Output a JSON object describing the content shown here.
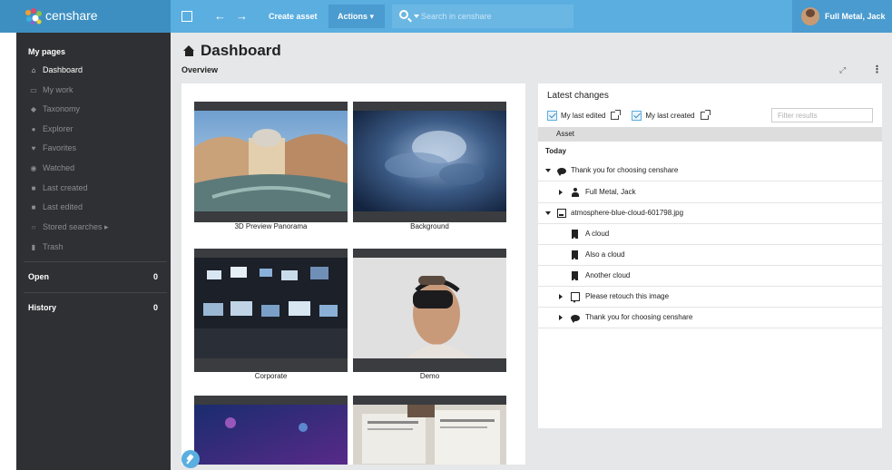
{
  "app": {
    "brand": "censhare",
    "colors": {
      "topbar": "#5aaee0",
      "logo_bg": "#3d8fc2",
      "sidebar": "#2f3033",
      "main_bg": "#e6e7e8"
    }
  },
  "topbar": {
    "panel_icon": "square-panel-icon",
    "back_icon": "←",
    "forward_icon": "→",
    "create_asset": "Create asset",
    "actions": "Actions ▾",
    "search_placeholder": "Search in censhare",
    "user_name": "Full Metal, Jack"
  },
  "sidebar": {
    "my_pages": "My pages",
    "items": [
      {
        "icon": "home-icon",
        "glyph": "⌂",
        "label": "Dashboard",
        "active": true
      },
      {
        "icon": "monitor-icon",
        "glyph": "▭",
        "label": "My work",
        "active": false
      },
      {
        "icon": "tag-icon",
        "glyph": "◆",
        "label": "Taxonomy",
        "active": false
      },
      {
        "icon": "compass-icon",
        "glyph": "●",
        "label": "Explorer",
        "active": false
      },
      {
        "icon": "heart-icon",
        "glyph": "♥",
        "label": "Favorites",
        "active": false
      },
      {
        "icon": "eye-icon",
        "glyph": "◉",
        "label": "Watched",
        "active": false
      },
      {
        "icon": "plus-doc-icon",
        "glyph": "■",
        "label": "Last created",
        "active": false
      },
      {
        "icon": "edit-doc-icon",
        "glyph": "■",
        "label": "Last edited",
        "active": false
      },
      {
        "icon": "search-icon",
        "glyph": "○",
        "label": "Stored searches ▸",
        "active": false
      },
      {
        "icon": "trash-icon",
        "glyph": "▮",
        "label": "Trash",
        "active": false
      }
    ],
    "open": {
      "label": "Open",
      "count": "0"
    },
    "history": {
      "label": "History",
      "count": "0"
    }
  },
  "main": {
    "title": "Dashboard",
    "subtitle": "Overview",
    "expand_icon": "⤢",
    "more_icon": "⋮"
  },
  "tiles": [
    {
      "caption": "3D Preview Panorama",
      "thumb": "panorama"
    },
    {
      "caption": "Background",
      "thumb": "clouds"
    },
    {
      "caption": "Corporate",
      "thumb": "control-room"
    },
    {
      "caption": "Demo",
      "thumb": "vr-headset"
    },
    {
      "caption": "",
      "thumb": "concert"
    },
    {
      "caption": "",
      "thumb": "newspaper"
    }
  ],
  "latest_changes": {
    "title": "Latest changes",
    "my_last_edited": "My last edited",
    "my_last_created": "My last created",
    "filter_placeholder": "Filter results",
    "column_asset": "Asset",
    "group_today": "Today",
    "rows": [
      {
        "indent": 0,
        "toggle": "down",
        "icon": "comment-icon",
        "label": "Thank you for choosing censhare"
      },
      {
        "indent": 1,
        "toggle": "right",
        "icon": "person-icon",
        "label": "Full Metal, Jack"
      },
      {
        "indent": 0,
        "toggle": "down",
        "icon": "image-icon",
        "label": "atmosphere-blue-cloud-601798.jpg"
      },
      {
        "indent": 1,
        "toggle": "none",
        "icon": "bookmark-icon",
        "label": "A cloud"
      },
      {
        "indent": 1,
        "toggle": "none",
        "icon": "bookmark-icon",
        "label": "Also a cloud"
      },
      {
        "indent": 1,
        "toggle": "none",
        "icon": "bookmark-icon",
        "label": "Another cloud"
      },
      {
        "indent": 1,
        "toggle": "right",
        "icon": "task-icon",
        "label": "Please retouch this image"
      },
      {
        "indent": 1,
        "toggle": "right",
        "icon": "comment-icon",
        "label": "Thank you for choosing censhare"
      }
    ]
  }
}
